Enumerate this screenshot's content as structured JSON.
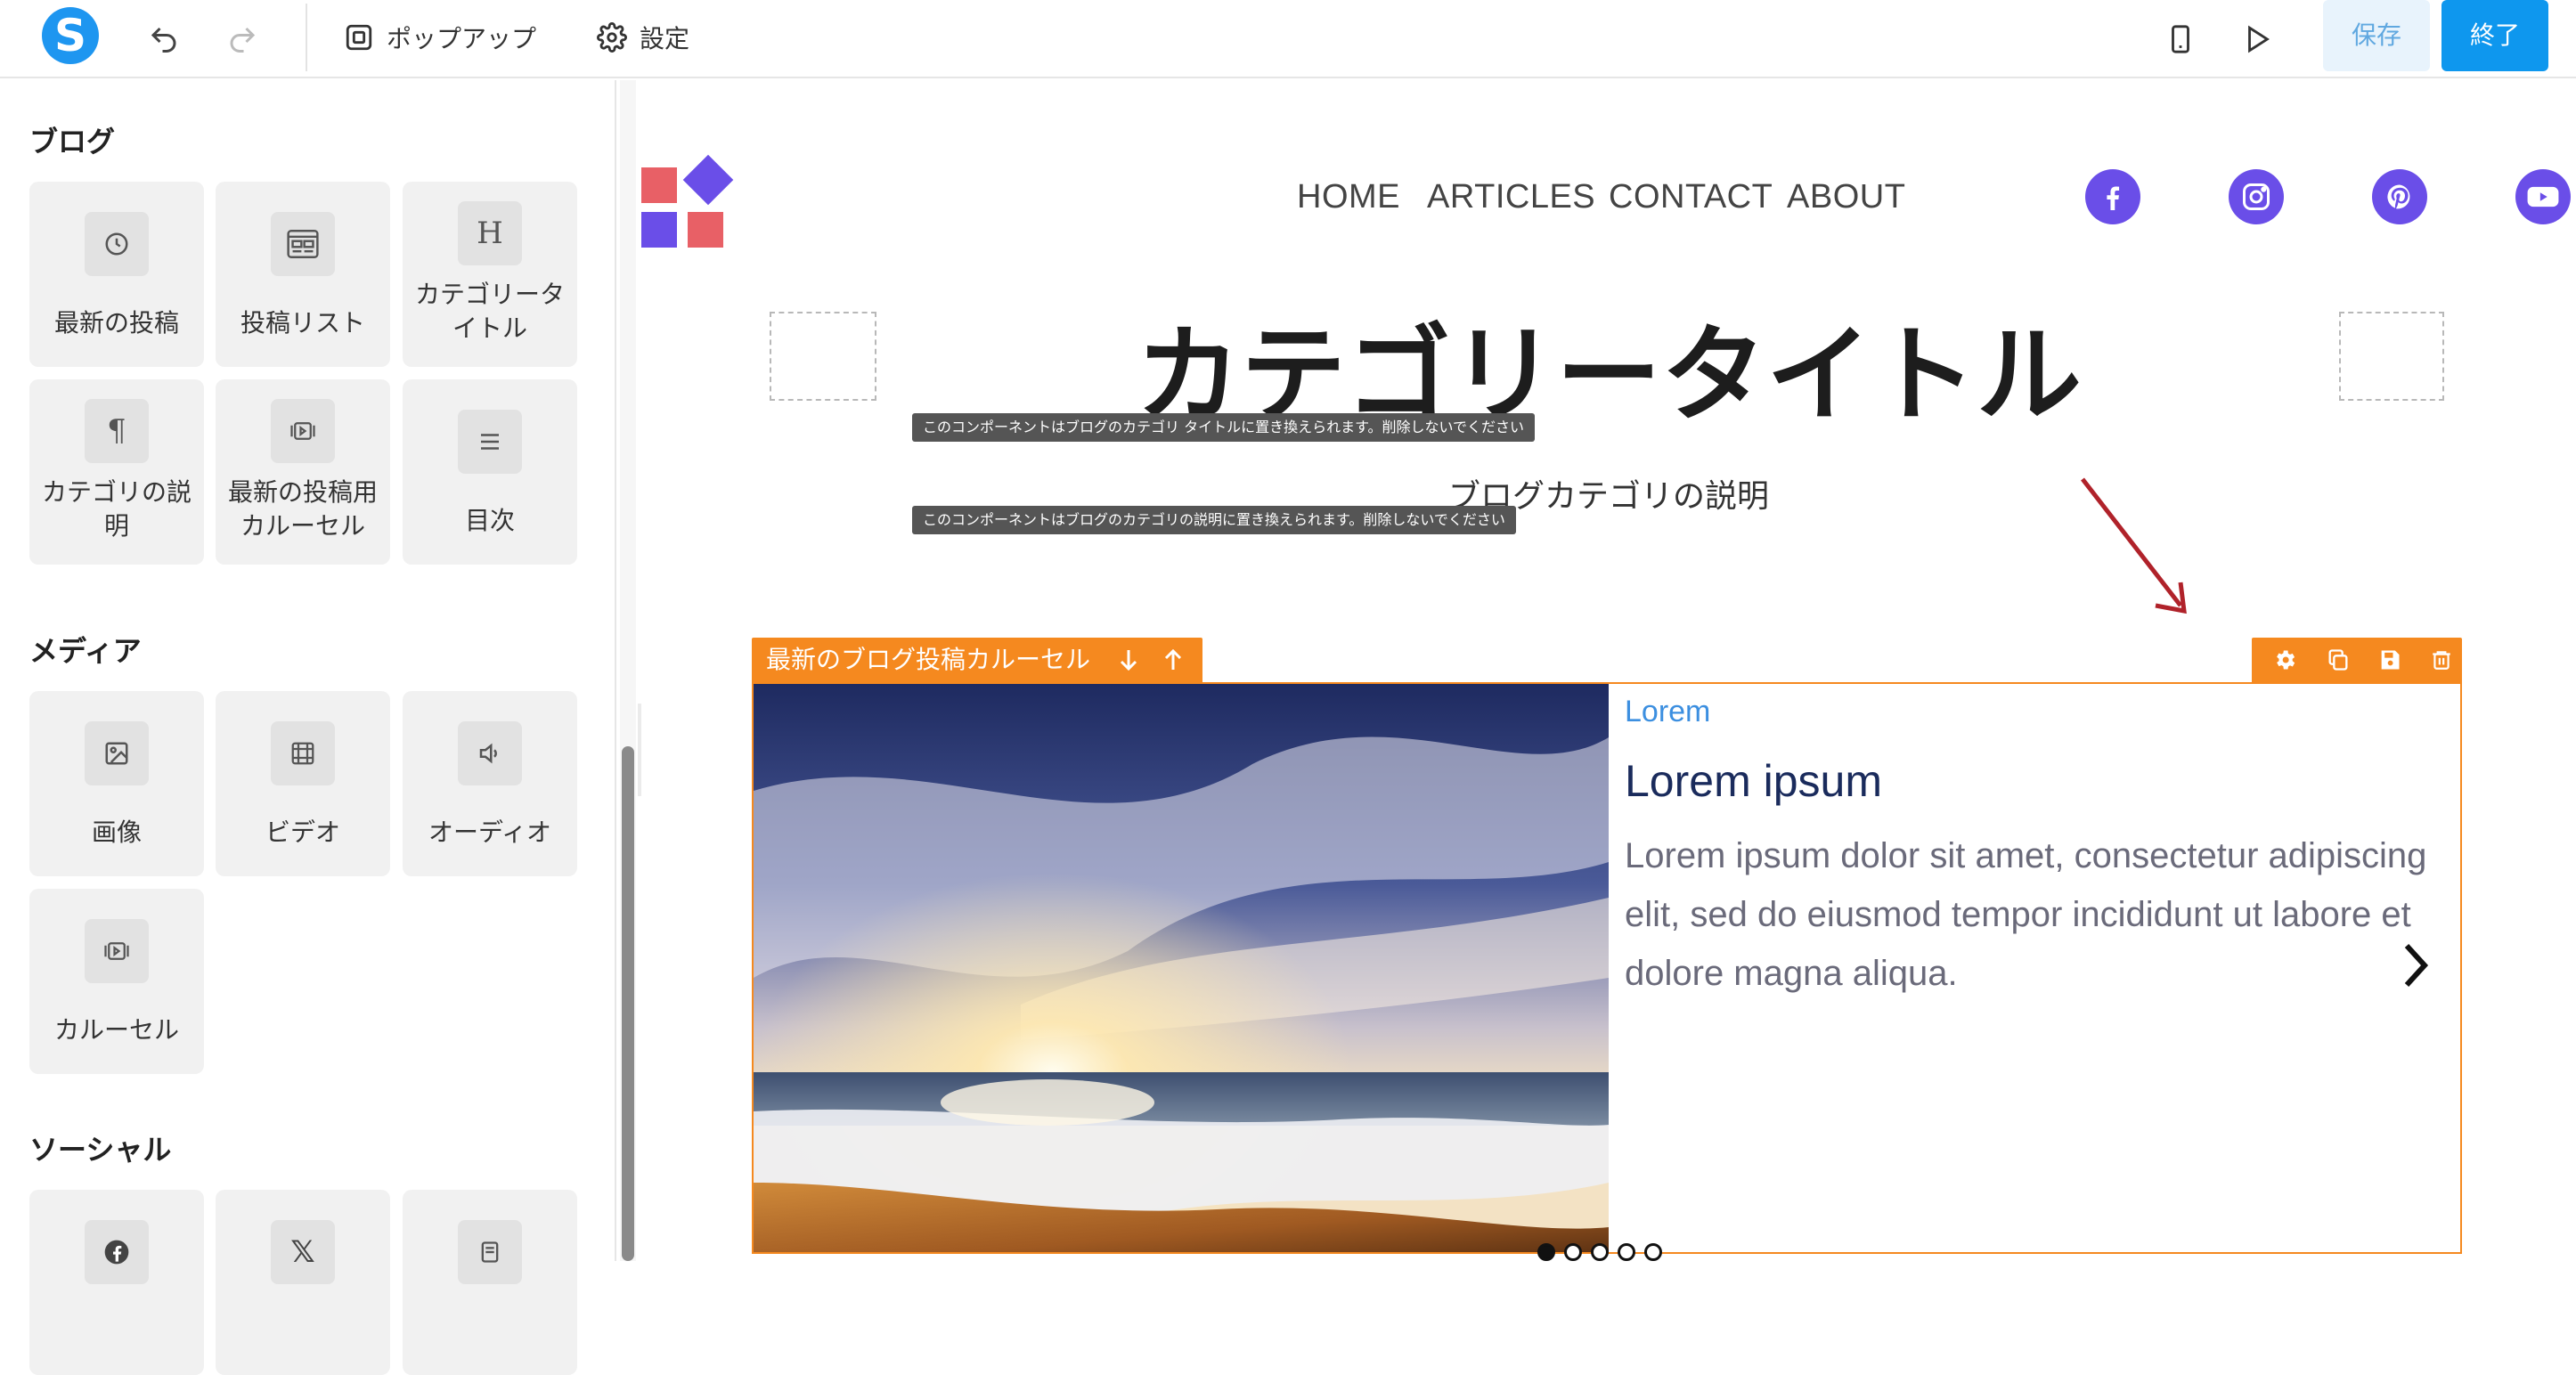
{
  "topbar": {
    "logo_letter": "S",
    "popup_label": "ポップアップ",
    "settings_label": "設定",
    "save_label": "保存",
    "done_label": "終了"
  },
  "sidebar": {
    "sections": [
      {
        "title": "ブログ",
        "items": [
          {
            "label": "最新の投稿",
            "icon": "clock-icon"
          },
          {
            "label": "投稿リスト",
            "icon": "post-list-icon"
          },
          {
            "label": "カテゴリータイトル",
            "icon": "heading-icon"
          },
          {
            "label": "カテゴリの説明",
            "icon": "paragraph-icon"
          },
          {
            "label": "最新の投稿用カルーセル",
            "icon": "carousel-icon"
          },
          {
            "label": "目次",
            "icon": "list-icon"
          }
        ]
      },
      {
        "title": "メディア",
        "items": [
          {
            "label": "画像",
            "icon": "image-icon"
          },
          {
            "label": "ビデオ",
            "icon": "video-icon"
          },
          {
            "label": "オーディオ",
            "icon": "audio-icon"
          },
          {
            "label": "カルーセル",
            "icon": "carousel-icon"
          }
        ]
      },
      {
        "title": "ソーシャル",
        "items": [
          {
            "label": "",
            "icon": "facebook-icon"
          },
          {
            "label": "",
            "icon": "x-icon"
          },
          {
            "label": "",
            "icon": "form-icon"
          }
        ]
      }
    ]
  },
  "canvas": {
    "nav": [
      "HOME",
      "ARTICLES",
      "CONTACT",
      "ABOUT"
    ],
    "social": [
      "facebook-icon",
      "instagram-icon",
      "pinterest-icon",
      "youtube-icon"
    ],
    "category_title": "カテゴリータイトル",
    "category_title_notice": "このコンポーネントはブログのカテゴリ タイトルに置き換えられます。削除しないでください",
    "category_desc": "ブログカテゴリの説明",
    "category_desc_notice": "このコンポーネントはブログのカテゴリの説明に置き換えられます。削除しないでください",
    "carousel": {
      "label": "最新のブログ投稿カルーセル",
      "tag": "Lorem",
      "title": "Lorem ipsum",
      "body": "Lorem ipsum dolor sit amet, consectetur adipiscing elit, sed do eiusmod tempor incididunt ut labore et dolore magna aliqua.",
      "slides": 5,
      "active_slide": 1
    },
    "colors": {
      "accent": "#f5891f",
      "brand": "#6a4ee8",
      "highlight": "#a51d24"
    }
  }
}
